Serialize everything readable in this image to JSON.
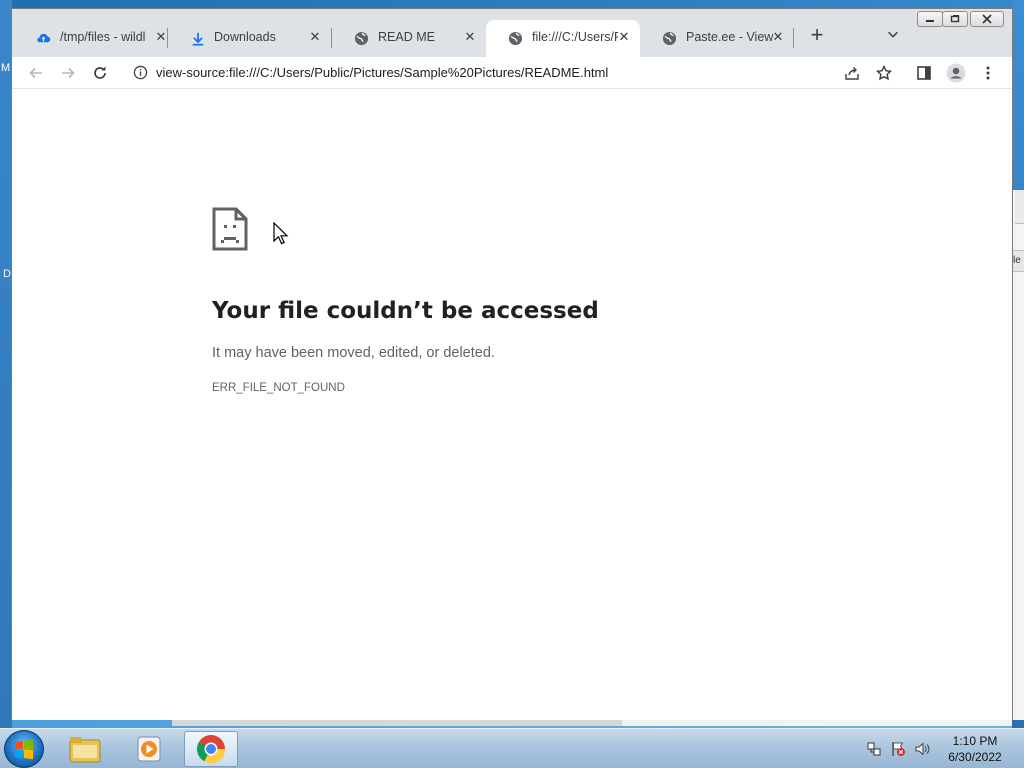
{
  "desktop": {
    "left_text_1": "M",
    "left_text_2": "D",
    "right_text": "le"
  },
  "browser": {
    "tabs": [
      {
        "title": "/tmp/files - wildl",
        "icon": "cloud-upload-icon",
        "active": false
      },
      {
        "title": "Downloads",
        "icon": "download-icon",
        "active": false
      },
      {
        "title": "READ ME",
        "icon": "globe-icon",
        "active": false
      },
      {
        "title": "file:///C:/Users/P",
        "icon": "globe-icon",
        "active": true
      },
      {
        "title": "Paste.ee - View p",
        "icon": "globe-icon",
        "active": false
      }
    ],
    "address_bar": {
      "url": "view-source:file:///C:/Users/Public/Pictures/Sample%20Pictures/README.html"
    }
  },
  "page": {
    "error_title": "Your file couldn’t be accessed",
    "error_message": "It may have been moved, edited, or deleted.",
    "error_code": "ERR_FILE_NOT_FOUND"
  },
  "taskbar": {
    "apps": [
      "file-explorer",
      "media-player",
      "chrome"
    ],
    "clock_time": "1:10 PM",
    "clock_date": "6/30/2022"
  },
  "colors": {
    "titlebar": "#dee1e6",
    "taskbar": "#a9c4de",
    "error_title": "#202124",
    "error_text": "#5f6368"
  }
}
